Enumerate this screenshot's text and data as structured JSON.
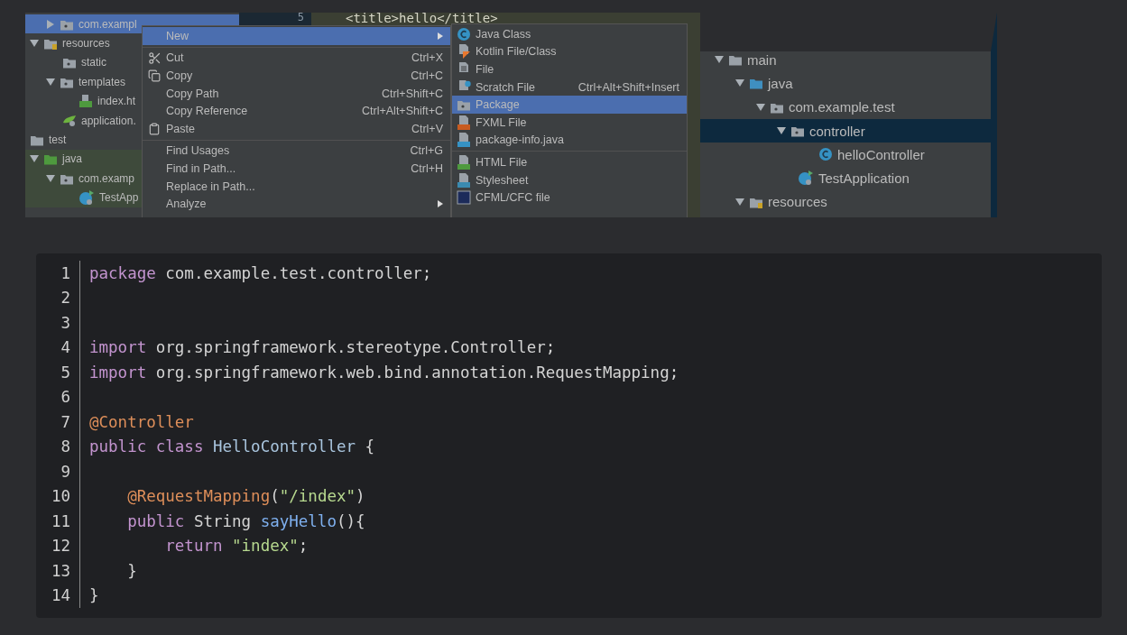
{
  "ide_left": {
    "gutter_number": "5",
    "editor_text": "<title>hello</title>",
    "tree": [
      {
        "label": "com.exampl",
        "kind": "package",
        "expanded": false,
        "selected": true
      },
      {
        "label": "resources",
        "kind": "resources",
        "expanded": true,
        "selected": false,
        "children": [
          {
            "label": "static",
            "kind": "package",
            "selected": false
          },
          {
            "label": "templates",
            "kind": "package",
            "expanded": true,
            "selected": false,
            "children": [
              {
                "label": "index.ht",
                "kind": "html",
                "selected": false
              }
            ]
          },
          {
            "label": "application.",
            "kind": "config",
            "selected": false
          }
        ]
      },
      {
        "label": "test",
        "kind": "folder",
        "selected": false
      },
      {
        "label": "java",
        "kind": "test-folder",
        "expanded": true,
        "selected": false,
        "tinted": true,
        "children": [
          {
            "label": "com.examp",
            "kind": "package",
            "expanded": true,
            "selected": false,
            "tinted": true,
            "children": [
              {
                "label": "TestApp",
                "kind": "app",
                "selected": false,
                "tinted": true
              }
            ]
          }
        ]
      }
    ],
    "menu": [
      {
        "kind": "plain",
        "label": "New",
        "selected": true,
        "submenu": true
      },
      {
        "kind": "separator"
      },
      {
        "kind": "cut",
        "label": "Cut",
        "shortcut": "Ctrl+X",
        "selected": false
      },
      {
        "kind": "copy",
        "label": "Copy",
        "shortcut": "Ctrl+C",
        "selected": false
      },
      {
        "kind": "plain",
        "label": "Copy Path",
        "shortcut": "Ctrl+Shift+C",
        "selected": false
      },
      {
        "kind": "plain",
        "label": "Copy Reference",
        "shortcut": "Ctrl+Alt+Shift+C",
        "selected": false
      },
      {
        "kind": "paste",
        "label": "Paste",
        "shortcut": "Ctrl+V",
        "selected": false
      },
      {
        "kind": "separator"
      },
      {
        "kind": "plain",
        "label": "Find Usages",
        "shortcut": "Ctrl+G",
        "selected": false
      },
      {
        "kind": "plain",
        "label": "Find in Path...",
        "shortcut": "Ctrl+H",
        "selected": false
      },
      {
        "kind": "plain",
        "label": "Replace in Path...",
        "selected": false
      },
      {
        "kind": "plain",
        "label": "Analyze",
        "selected": false,
        "submenu": true
      }
    ],
    "submenu": [
      {
        "kind": "class",
        "label": "Java Class",
        "selected": false
      },
      {
        "kind": "kotlin",
        "label": "Kotlin File/Class",
        "selected": false
      },
      {
        "kind": "file",
        "label": "File",
        "selected": false
      },
      {
        "kind": "scratch",
        "label": "Scratch File",
        "shortcut": "Ctrl+Alt+Shift+Insert",
        "selected": false
      },
      {
        "kind": "package",
        "label": "Package",
        "selected": true
      },
      {
        "kind": "fxml",
        "label": "FXML File",
        "selected": false
      },
      {
        "kind": "java-file",
        "label": "package-info.java",
        "selected": false
      },
      {
        "kind": "separator"
      },
      {
        "kind": "html",
        "label": "HTML File",
        "selected": false
      },
      {
        "kind": "css",
        "label": "Stylesheet",
        "selected": false
      },
      {
        "kind": "cfml",
        "label": "CFML/CFC file",
        "selected": false
      }
    ]
  },
  "ide_right": {
    "tree": [
      {
        "label": "main",
        "kind": "folder",
        "expanded": true,
        "selected": false,
        "children": [
          {
            "label": "java",
            "kind": "source-folder",
            "expanded": true,
            "selected": false,
            "children": [
              {
                "label": "com.example.test",
                "kind": "package",
                "expanded": true,
                "selected": false,
                "children": [
                  {
                    "label": "controller",
                    "kind": "package",
                    "expanded": true,
                    "selected": true,
                    "children": [
                      {
                        "label": "helloController",
                        "kind": "class",
                        "selected": false
                      }
                    ]
                  },
                  {
                    "label": "TestApplication",
                    "kind": "app",
                    "selected": false
                  }
                ]
              }
            ]
          },
          {
            "label": "resources",
            "kind": "resources",
            "expanded": true,
            "selected": false
          }
        ]
      }
    ]
  },
  "code": {
    "lines": [
      {
        "number": "1",
        "tokens": [
          {
            "kind": "keyword",
            "text": "package"
          },
          {
            "kind": "plain",
            "text": " com.example.test.controller;"
          }
        ]
      },
      {
        "number": "2"
      },
      {
        "number": "3"
      },
      {
        "number": "4",
        "tokens": [
          {
            "kind": "keyword",
            "text": "import"
          },
          {
            "kind": "plain",
            "text": " org.springframework.stereotype.Controller;"
          }
        ]
      },
      {
        "number": "5",
        "tokens": [
          {
            "kind": "keyword",
            "text": "import"
          },
          {
            "kind": "plain",
            "text": " org.springframework.web.bind.annotation.RequestMapping;"
          }
        ]
      },
      {
        "number": "6"
      },
      {
        "number": "7",
        "tokens": [
          {
            "kind": "annotation",
            "text": "@Controller"
          }
        ]
      },
      {
        "number": "8",
        "tokens": [
          {
            "kind": "keyword",
            "text": "public class"
          },
          {
            "kind": "type",
            "text": " HelloController"
          },
          {
            "kind": "plain",
            "text": " {"
          }
        ]
      },
      {
        "number": "9"
      },
      {
        "number": "10",
        "tokens": [
          {
            "kind": "annotation",
            "text": "    @RequestMapping"
          },
          {
            "kind": "plain",
            "text": "("
          },
          {
            "kind": "string",
            "text": "\"/index\""
          },
          {
            "kind": "plain",
            "text": ")"
          }
        ]
      },
      {
        "number": "11",
        "tokens": [
          {
            "kind": "keyword",
            "text": "    public"
          },
          {
            "kind": "plain",
            "text": " String "
          },
          {
            "kind": "method",
            "text": "sayHello"
          },
          {
            "kind": "plain",
            "text": "(){"
          }
        ]
      },
      {
        "number": "12",
        "tokens": [
          {
            "kind": "keyword",
            "text": "        return"
          },
          {
            "kind": "string",
            "text": " \"index\""
          },
          {
            "kind": "plain",
            "text": ";"
          }
        ]
      },
      {
        "number": "13",
        "tokens": [
          {
            "kind": "plain",
            "text": "    }"
          }
        ]
      },
      {
        "number": "14",
        "tokens": [
          {
            "kind": "plain",
            "text": "}"
          }
        ]
      }
    ]
  }
}
